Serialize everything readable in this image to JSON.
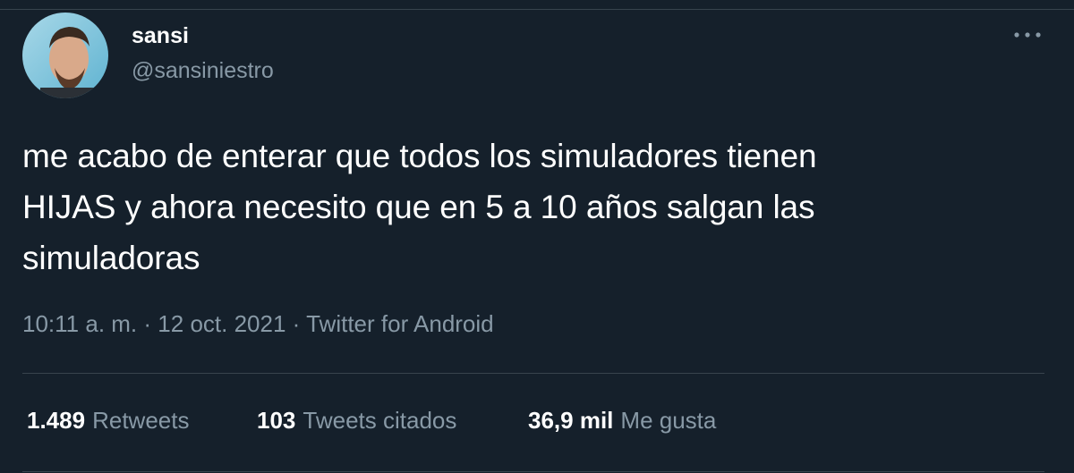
{
  "author": {
    "display_name": "sansi",
    "handle": "@sansiniestro",
    "avatar_icon": "profile-photo"
  },
  "tweet": {
    "lines": [
      "me acabo de enterar que todos los simuladores tienen",
      "HIJAS y ahora necesito que en 5 a 10 años salgan las",
      "simuladoras"
    ]
  },
  "meta": {
    "time": "10:11 a. m.",
    "separator": "·",
    "date": "12 oct. 2021",
    "source": "Twitter for Android"
  },
  "stats": {
    "retweets": {
      "count": "1.489",
      "label": "Retweets"
    },
    "quotes": {
      "count": "103",
      "label": "Tweets citados"
    },
    "likes": {
      "count": "36,9 mil",
      "label": "Me gusta"
    }
  },
  "colors": {
    "background": "#15202b",
    "primary_text": "#ffffff",
    "secondary_text": "#8899a6",
    "border": "#38444d"
  },
  "more_icon": "more-horizontal-icon"
}
